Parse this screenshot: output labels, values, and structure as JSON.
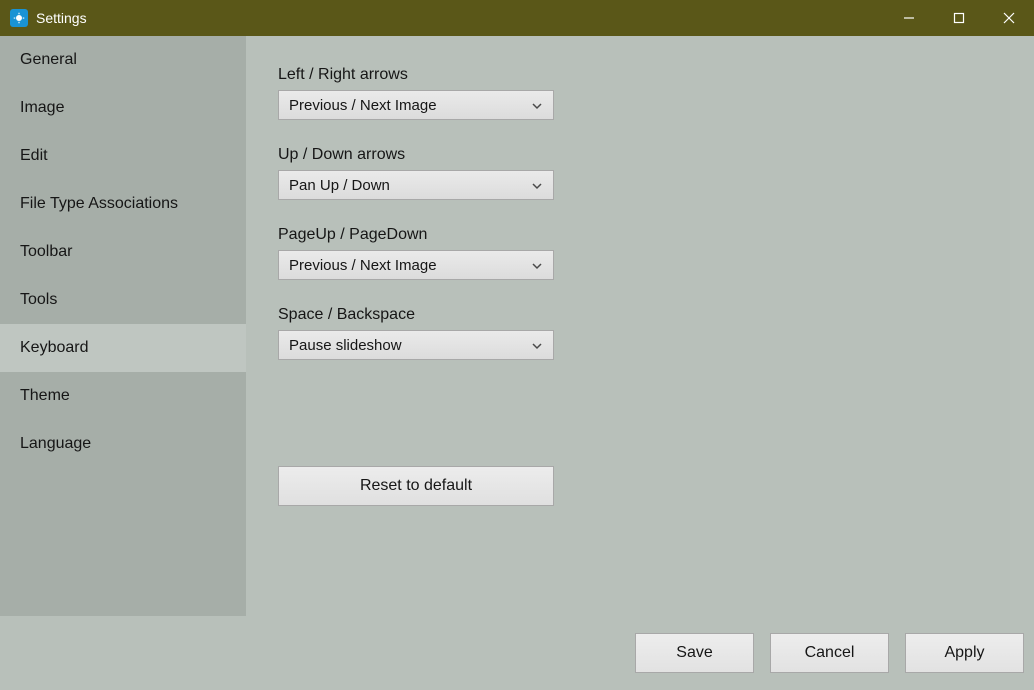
{
  "window": {
    "title": "Settings"
  },
  "sidebar": {
    "items": [
      {
        "label": "General",
        "active": false
      },
      {
        "label": "Image",
        "active": false
      },
      {
        "label": "Edit",
        "active": false
      },
      {
        "label": "File Type Associations",
        "active": false
      },
      {
        "label": "Toolbar",
        "active": false
      },
      {
        "label": "Tools",
        "active": false
      },
      {
        "label": "Keyboard",
        "active": true
      },
      {
        "label": "Theme",
        "active": false
      },
      {
        "label": "Language",
        "active": false
      }
    ]
  },
  "settings": {
    "leftRight": {
      "label": "Left / Right arrows",
      "value": "Previous / Next Image"
    },
    "upDown": {
      "label": "Up / Down arrows",
      "value": "Pan Up / Down"
    },
    "pageUpDown": {
      "label": "PageUp / PageDown",
      "value": "Previous / Next Image"
    },
    "spaceBackspace": {
      "label": "Space / Backspace",
      "value": "Pause slideshow"
    },
    "resetLabel": "Reset to default"
  },
  "footer": {
    "save": "Save",
    "cancel": "Cancel",
    "apply": "Apply"
  }
}
